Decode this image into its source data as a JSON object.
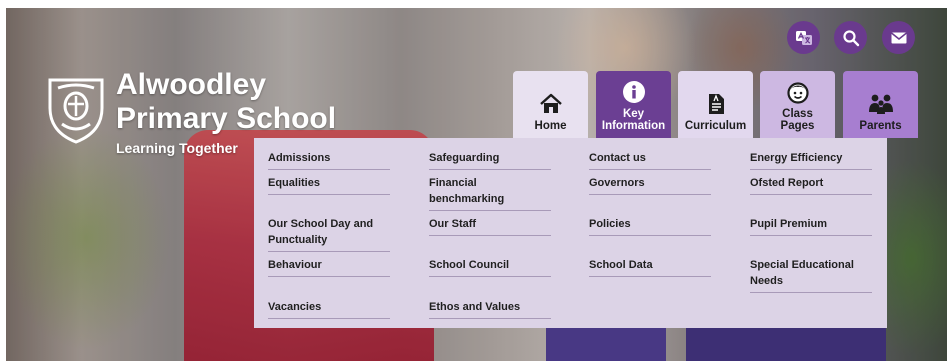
{
  "header": {
    "school_name_line1": "Alwoodley",
    "school_name_line2": "Primary School",
    "tagline": "Learning Together"
  },
  "top_icons": [
    {
      "name": "translate-icon"
    },
    {
      "name": "search-icon"
    },
    {
      "name": "mail-icon"
    }
  ],
  "nav": {
    "home": "Home",
    "key_line1": "Key",
    "key_line2": "Information",
    "curriculum": "Curriculum",
    "class_line1": "Class",
    "class_line2": "Pages",
    "parents": "Parents"
  },
  "dropdown": {
    "col1": [
      "Admissions",
      "Equalities",
      "Our School Day and Punctuality",
      "Behaviour",
      "Vacancies"
    ],
    "col2": [
      "Safeguarding",
      "Financial benchmarking",
      "Our Staff",
      "School Council",
      "Ethos and Values"
    ],
    "col3": [
      "Contact us",
      "Governors",
      "Policies",
      "School Data"
    ],
    "col4": [
      "Energy Efficiency",
      "Ofsted Report",
      "Pupil Premium",
      "Special Educational Needs"
    ]
  },
  "colors": {
    "accent_purple": "#6b3f93",
    "dropdown_bg": "#dcd3e6",
    "tile_light": "#e8e1f0",
    "tile_parents": "#a77ed0"
  }
}
